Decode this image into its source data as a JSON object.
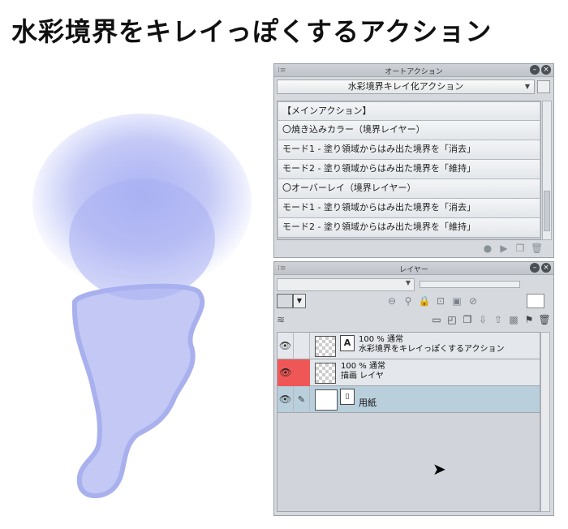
{
  "heading": "水彩境界をキレイっぽくするアクション",
  "auto_action": {
    "title": "オートアクション",
    "set_name": "水彩境界キレイ化アクション",
    "items": [
      "【メインアクション】",
      "〇焼き込みカラー（境界レイヤー）",
      "モード1 - 塗り領域からはみ出た境界を「消去」",
      "モード2 - 塗り領域からはみ出た境界を「維持」",
      "〇オーバーレイ（境界レイヤー）",
      "モード1 - 塗り領域からはみ出た境界を「消去」",
      "モード2 - 塗り領域からはみ出た境界を「維持」"
    ]
  },
  "layer_panel": {
    "title": "レイヤー",
    "layers": [
      {
        "meta": "100 %  通常",
        "name": "水彩境界をキレイっぽくするアクション"
      },
      {
        "meta": "100 %  通常",
        "name": "描画 レイヤ"
      },
      {
        "name": "用紙"
      }
    ]
  },
  "colors": {
    "panel_bg": "#d6dadf",
    "selected_row": "#b9cfdc",
    "active_marker": "#ef5757",
    "watercolor": "#b5bcf5"
  }
}
